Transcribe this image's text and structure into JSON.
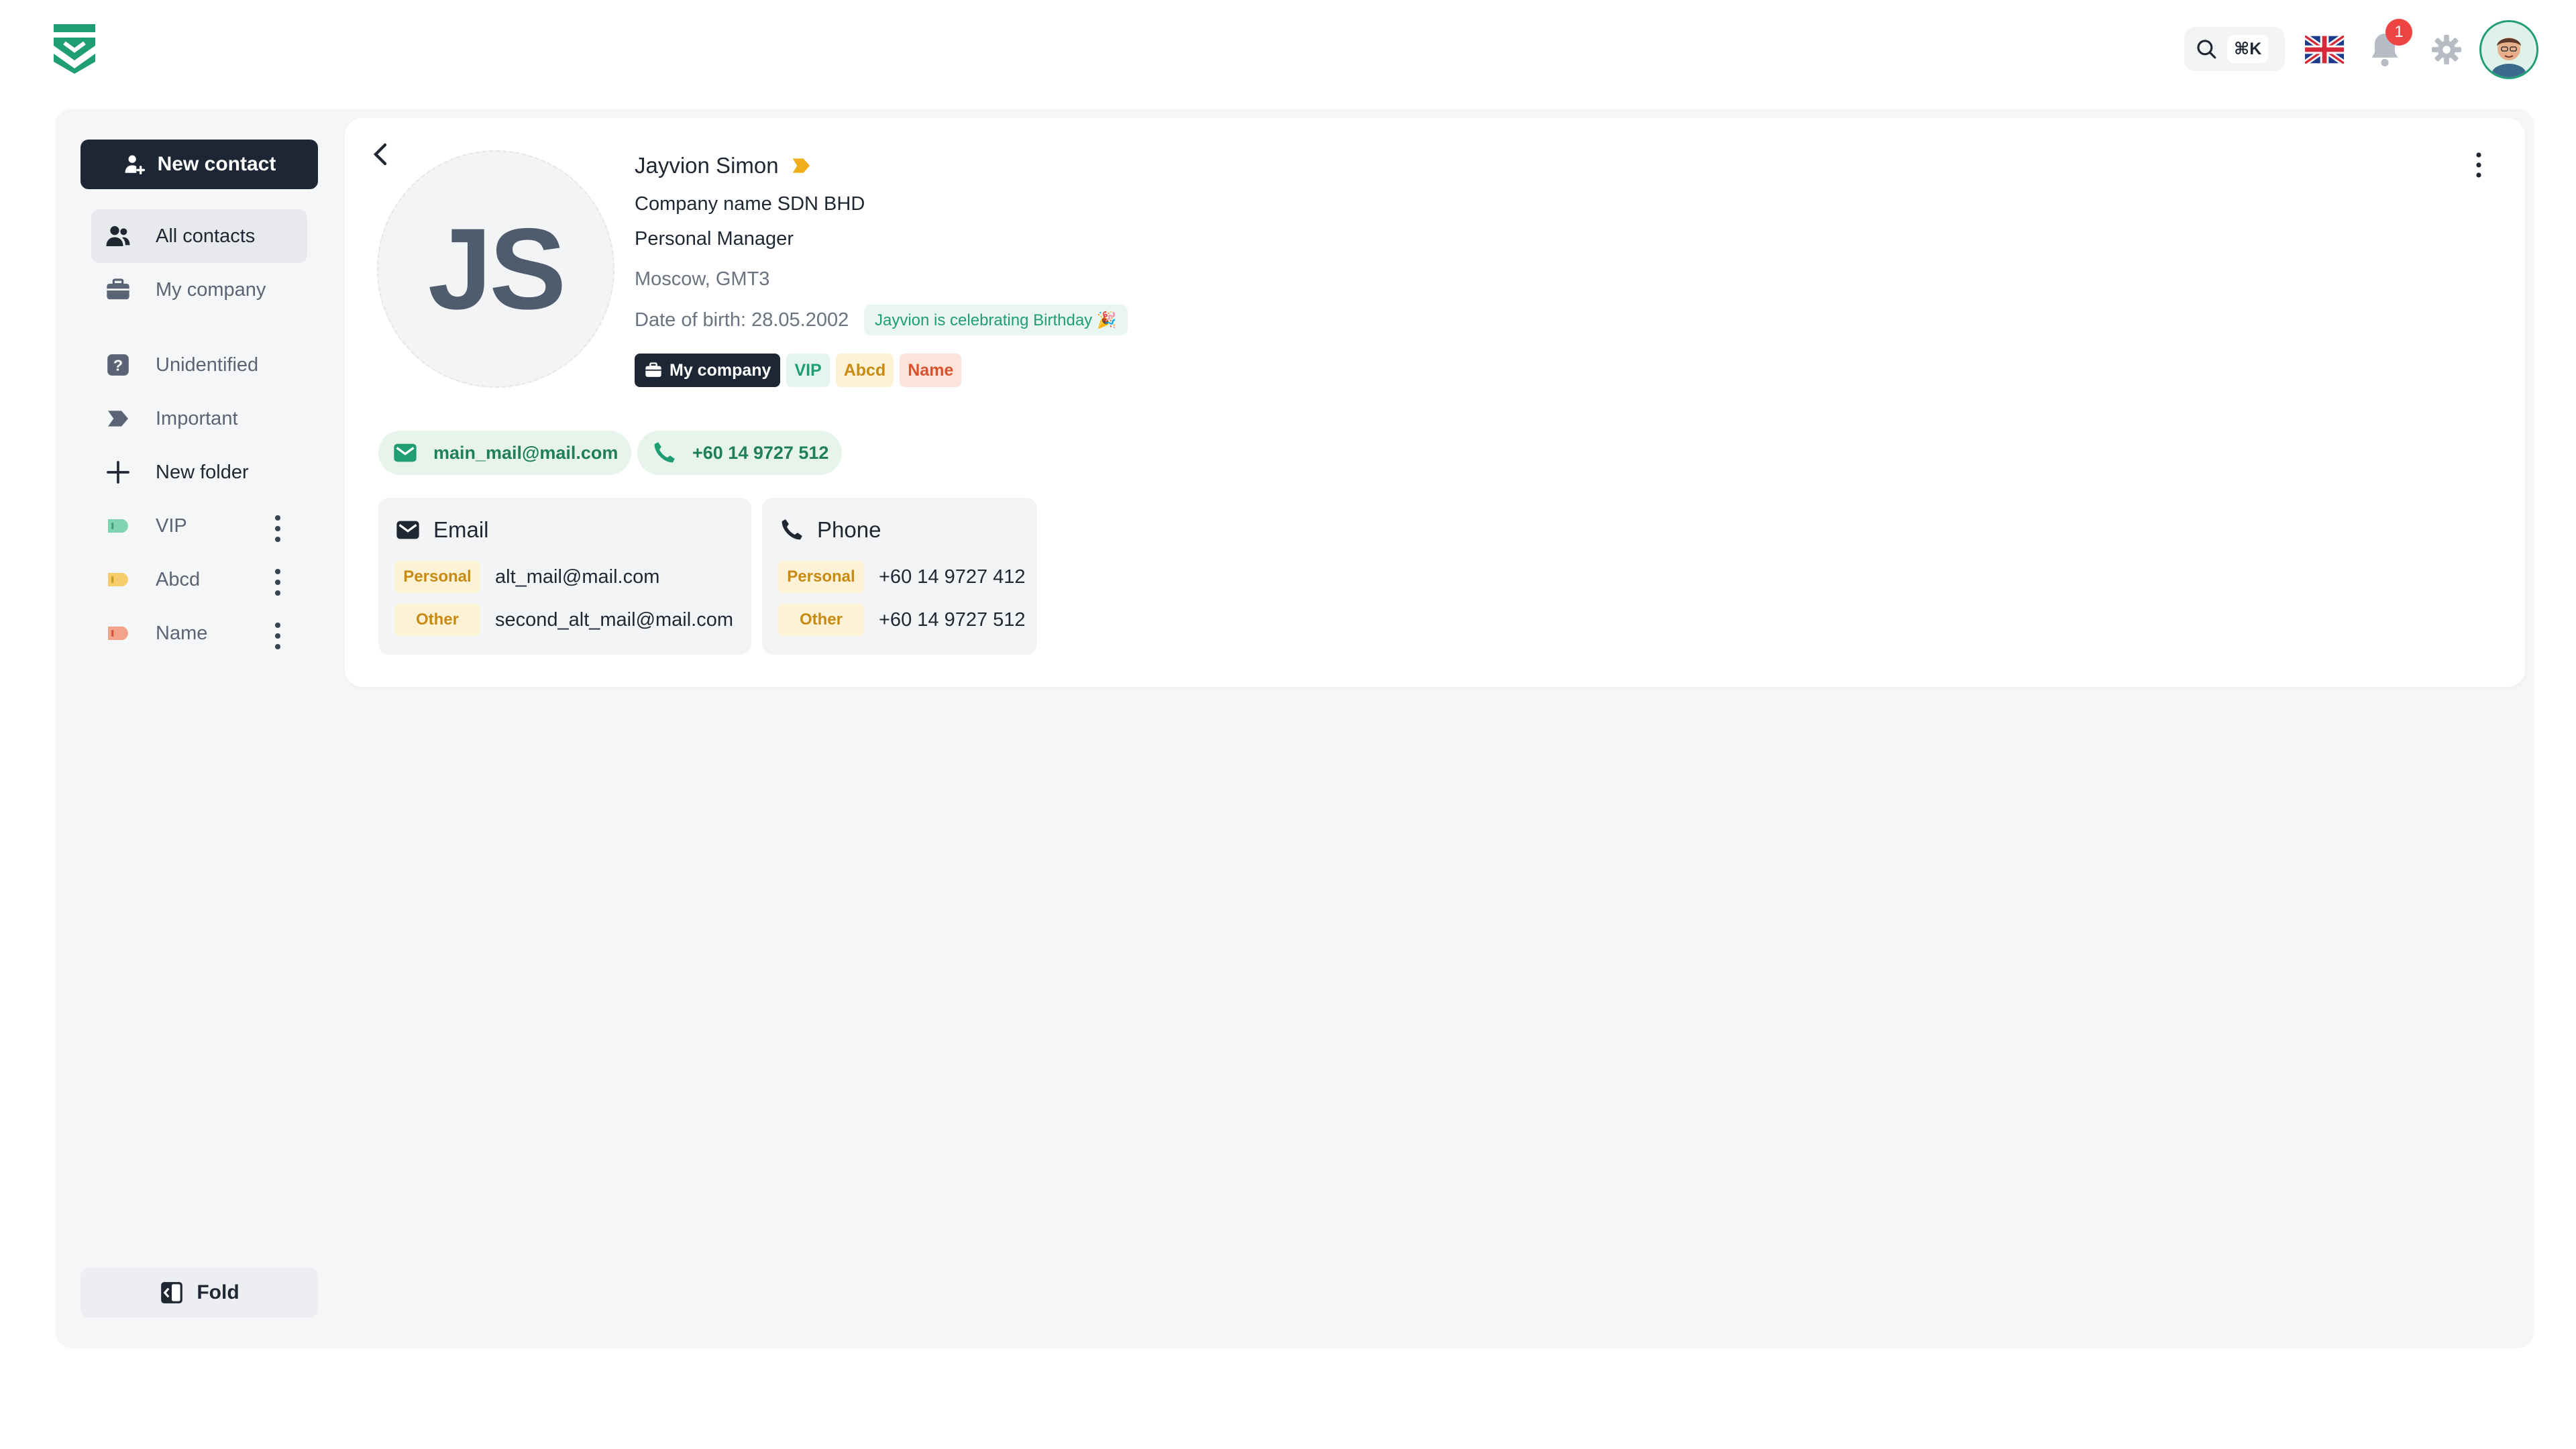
{
  "topbar": {
    "search_shortcut": "⌘K",
    "notification_count": "1",
    "language_flag": "uk-flag-icon",
    "colors": {
      "brand": "#1f9e73",
      "badge": "#ef4444"
    }
  },
  "sidebar": {
    "new_contact_label": "New contact",
    "items": [
      {
        "label": "All contacts",
        "icon": "users-icon",
        "active": true
      },
      {
        "label": "My company",
        "icon": "briefcase-icon"
      },
      {
        "label": "Unidentified",
        "icon": "question-icon"
      },
      {
        "label": "Important",
        "icon": "important-tag-icon"
      },
      {
        "label": "New folder",
        "icon": "plus-icon"
      },
      {
        "label": "VIP",
        "icon": "tag-icon",
        "color": "#7fd3b1"
      },
      {
        "label": "Abcd",
        "icon": "tag-icon",
        "color": "#f6cd6a"
      },
      {
        "label": "Name",
        "icon": "tag-icon",
        "color": "#f2a48a"
      }
    ],
    "fold_label": "Fold"
  },
  "contact": {
    "initials": "JS",
    "name": "Jayvion Simon",
    "company": "Company name SDN BHD",
    "position": "Personal Manager",
    "location": "Moscow, GMT3",
    "birth": "Date of birth: 28.05.2002",
    "birthday_note": "Jayvion is celebrating Birthday 🎉",
    "tags": {
      "company": "My company",
      "vip": "VIP",
      "abcd": "Abcd",
      "name": "Name"
    },
    "main_email": "main_mail@mail.com",
    "main_phone": "+60 14 9727 512",
    "email_section": {
      "title": "Email",
      "rows": [
        {
          "label": "Personal",
          "value": "alt_mail@mail.com"
        },
        {
          "label": "Other",
          "value": "second_alt_mail@mail.com"
        }
      ]
    },
    "phone_section": {
      "title": "Phone",
      "rows": [
        {
          "label": "Personal",
          "value": "+60 14 9727 412"
        },
        {
          "label": "Other",
          "value": "+60 14 9727 512"
        }
      ]
    }
  }
}
